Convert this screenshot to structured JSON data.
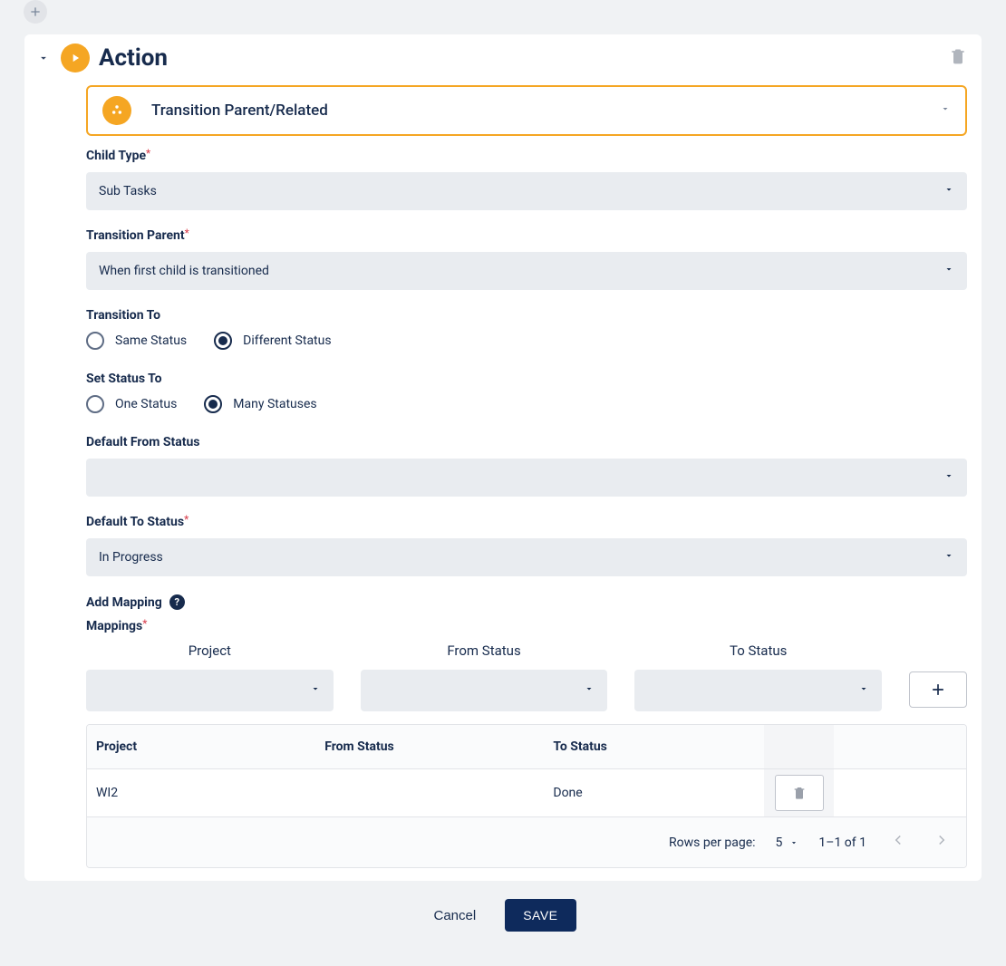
{
  "header": {
    "title": "Action"
  },
  "action_type": {
    "label": "Transition Parent/Related"
  },
  "fields": {
    "childType": {
      "label": "Child Type",
      "value": "Sub Tasks",
      "required": true
    },
    "transitionParent": {
      "label": "Transition Parent",
      "value": "When first child is transitioned",
      "required": true
    },
    "transitionTo": {
      "label": "Transition To",
      "options": [
        {
          "label": "Same Status",
          "checked": false
        },
        {
          "label": "Different Status",
          "checked": true
        }
      ]
    },
    "setStatusTo": {
      "label": "Set Status To",
      "options": [
        {
          "label": "One Status",
          "checked": false
        },
        {
          "label": "Many Statuses",
          "checked": true
        }
      ]
    },
    "defaultFromStatus": {
      "label": "Default From Status",
      "value": ""
    },
    "defaultToStatus": {
      "label": "Default To Status",
      "value": "In Progress",
      "required": true
    }
  },
  "mapping": {
    "addLabel": "Add Mapping",
    "mappingsLabel": "Mappings",
    "columns": {
      "project": "Project",
      "from": "From Status",
      "to": "To Status"
    },
    "newRow": {
      "project": "",
      "from": "",
      "to": ""
    },
    "rows": [
      {
        "project": "WI2",
        "from": "",
        "to": "Done"
      }
    ],
    "pager": {
      "rowsPerPageLabel": "Rows per page:",
      "rowsPerPage": "5",
      "rangeText": "1–1 of 1"
    }
  },
  "footer": {
    "cancel": "Cancel",
    "save": "SAVE"
  }
}
